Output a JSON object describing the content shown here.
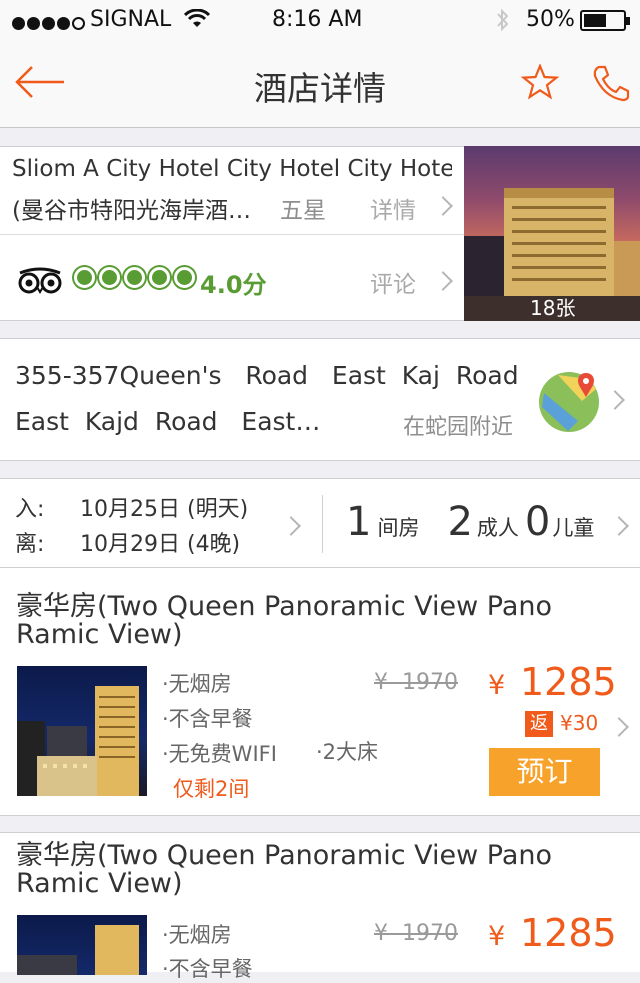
{
  "status": {
    "carrier": "SIGNAL",
    "time": "8:16 AM",
    "battery": "50%"
  },
  "nav": {
    "title": "酒店详情"
  },
  "hotel": {
    "name_line1": "Sliom A City Hotel City Hotel City Hotel",
    "name_line2": "(曼谷市特阳光海岸酒…",
    "stars": "五星",
    "details_label": "详情",
    "rating": "4.0分",
    "reviews_label": "评论",
    "photo_count": "18张"
  },
  "address": {
    "line1": "355-357Queen's   Road   East  Kaj  Road",
    "line2": "East  Kajd  Road   East…",
    "nearby": "在蛇园附近"
  },
  "booking": {
    "checkin_label": "入:",
    "checkin_date": "10月25日 (明天)",
    "checkout_label": "离:",
    "checkout_date": "10月29日 (4晚)",
    "rooms_num": "1",
    "rooms_label": "间房",
    "adults_num": "2",
    "adults_label": "成人",
    "children_num": "0",
    "children_label": "儿童"
  },
  "rooms": [
    {
      "title_line1": "豪华房(Two Queen Panoramic View Pano",
      "title_line2": "Ramic View)",
      "feat1": "·无烟房",
      "feat2": "·不含早餐",
      "feat3": "·无免费WIFI",
      "feat4": "·2大床",
      "remaining": "仅剩2间",
      "old_price": "¥  1970",
      "currency": "¥",
      "price": "1285",
      "rebate_tag": "返",
      "rebate": "¥30",
      "book_label": "预订"
    },
    {
      "title_line1": "豪华房(Two Queen Panoramic View Pano",
      "title_line2": "Ramic View)",
      "feat1": "·无烟房",
      "feat2": "·不含早餐",
      "old_price": "¥  1970",
      "currency": "¥",
      "price": "1285"
    }
  ],
  "colors": {
    "accent": "#f05a1a",
    "book_button": "#f7a22b",
    "rating_green": "#5a9c34"
  }
}
